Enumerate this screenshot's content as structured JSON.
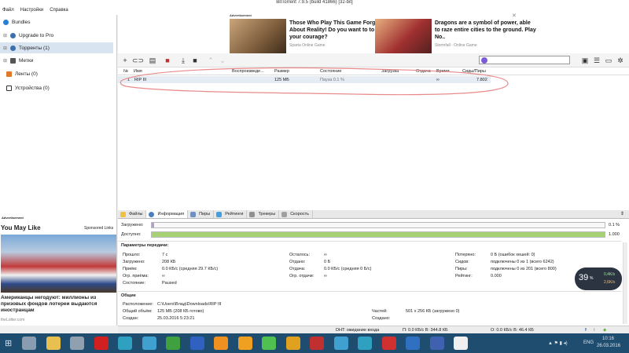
{
  "window": {
    "title": "BitTorrent 7.9.5  (build 41866) [32-bit]"
  },
  "menu": {
    "items": [
      "Файл",
      "Настройки",
      "Справка"
    ]
  },
  "sidebar": {
    "items": [
      {
        "label": "Bundles",
        "color": "#2a7fd4"
      },
      {
        "label": "Upgrade to Pro",
        "color": "#3a6fb0"
      },
      {
        "label": "Торренты (1)",
        "color": "#3a6fb0"
      },
      {
        "label": "Метки",
        "color": "#555555"
      },
      {
        "label": "Ленты (0)",
        "color": "#e07a2a"
      },
      {
        "label": "Устройства (0)",
        "color": "#333333"
      }
    ]
  },
  "ads": {
    "label": "Advertisement",
    "ad1": {
      "title": "Those Who Play This Game Forget About Reality! Do you want to to test your courage?",
      "source": "Sparta Online Game"
    },
    "ad2": {
      "title": "Dragons are a symbol of power, able to raze entire cities to the ground. Play No..",
      "source": "Stormfall - Online Game"
    }
  },
  "table": {
    "headers": [
      "№",
      "Имя",
      "Воспроизведе...",
      "Размер",
      "Состояние",
      "Загрузка",
      "Отдача",
      "Время",
      "Сиды/Пиры"
    ],
    "rows": [
      {
        "num": "1",
        "name": "RIP III",
        "play": "",
        "size": "125 МБ",
        "state": "Пауза 0.1 %",
        "down": "",
        "up": "",
        "time": "∞",
        "seeds": "7.802"
      }
    ]
  },
  "tabs": [
    "Файлы",
    "Информация",
    "Пиры",
    "Рейтинги",
    "Трекеры",
    "Скорость"
  ],
  "tab_colors": [
    "#f0c040",
    "#4a7fc0",
    "#7090c0",
    "#40a0e0",
    "#909090",
    "#a0a0a0"
  ],
  "detail": {
    "downloaded_label": "Загружено:",
    "downloaded_value": "0.1 %",
    "downloaded_fraction": 0.001,
    "available_label": "Доступно:",
    "available_value": "1.000",
    "available_fraction": 1.0,
    "transfer_title": "Параметры передачи:",
    "transfer": [
      {
        "k": "Прошло:",
        "v": "7 с"
      },
      {
        "k": "Загружено:",
        "v": "208 КБ"
      },
      {
        "k": "Приём:",
        "v": "0.0 КБ/с (средняя 29.7 КБ/с)"
      },
      {
        "k": "Огр. приёма:",
        "v": "∞"
      },
      {
        "k": "Состояние:",
        "v": "Paused"
      }
    ],
    "transfer2": [
      {
        "k": "Осталось:",
        "v": "∞"
      },
      {
        "k": "Отдано:",
        "v": "0 Б"
      },
      {
        "k": "Отдача:",
        "v": "0.0 КБ/с (средняя 0 Б/с)"
      },
      {
        "k": "Огр. отдачи:",
        "v": "∞"
      }
    ],
    "transfer3": [
      {
        "k": "Потеряно:",
        "v": "0 Б (ошибок хешей: 0)"
      },
      {
        "k": "Сидов:",
        "v": "подключены 0 из 1 (всего 6242)"
      },
      {
        "k": "Пиры:",
        "v": "подключены 0 из 201 (всего 800)"
      },
      {
        "k": "Рейтинг:",
        "v": "0.000"
      }
    ],
    "general_title": "Общие",
    "location_label": "Расположение:",
    "location_value": "C:\\Users\\Влад\\Downloads\\RIP III",
    "total_label": "Общий объём:",
    "total_value": "125 МБ (208 КБ готово)",
    "created_label": "Создан:",
    "created_value": "25.03.2016 5:23:21",
    "pieces_label": "Частей:",
    "pieces_value": "501 x 256 КБ (загружено 0)",
    "creator_label": "Создано:"
  },
  "left_ad": {
    "label": "Advertisement",
    "heading": "You May Like",
    "sponsored": "Sponsored Links",
    "headline": "Американцы негодуют: миллионы из призовых фондов лотереи выдаются иностранцам",
    "source": "theLotter.com"
  },
  "status": {
    "dht": "DHT: ожидание входа",
    "down": "П: 0.0 КБ/с В: 344.8 КБ",
    "up": "О: 0.0 КБ/с В: 46.4 КБ"
  },
  "badge": {
    "value": "39",
    "unit": "%",
    "up": "0,4K/s",
    "down": "2,6K/s"
  },
  "taskbar": {
    "lang": "ENG",
    "time": "10:16",
    "date": "26.03.2016",
    "colors": [
      "#8a9db0",
      "#e8c050",
      "#90a0b0",
      "#d02020",
      "#30a0c0",
      "#40a0d0",
      "#40a040",
      "#3060c0",
      "#f09020",
      "#f0a020",
      "#50c050",
      "#e0a020",
      "#c03030",
      "#40a0d0",
      "#30a0c0",
      "#d03030",
      "#3070c0",
      "#4060b0",
      "#f0f0f0"
    ]
  }
}
